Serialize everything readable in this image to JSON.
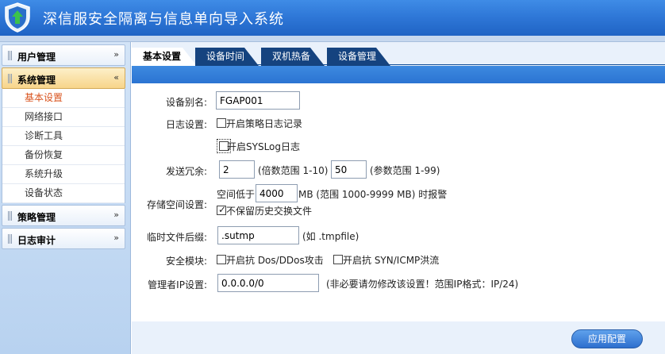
{
  "header": {
    "title": "深信服安全隔离与信息单向导入系统"
  },
  "sidebar": {
    "menus": [
      {
        "label": "用户管理",
        "chevron": "»"
      },
      {
        "label": "系统管理",
        "chevron": "«"
      },
      {
        "label": "策略管理",
        "chevron": "»"
      },
      {
        "label": "日志审计",
        "chevron": "»"
      }
    ],
    "submenu": [
      "基本设置",
      "网络接口",
      "诊断工具",
      "备份恢复",
      "系统升级",
      "设备状态"
    ]
  },
  "tabs": [
    "基本设置",
    "设备时间",
    "双机热备",
    "设备管理"
  ],
  "form": {
    "alias_label": "设备别名:",
    "alias_value": "FGAP001",
    "log_label": "日志设置:",
    "log_policy": "开启策略日志记录",
    "log_syslog": "开启SYSLog日志",
    "redundancy_label": "发送冗余:",
    "redundancy_value": "2",
    "redundancy_hint": "(倍数范围 1-10)",
    "param_value": "50",
    "param_hint": "(参数范围 1-99)",
    "storage_label": "存储空间设置:",
    "storage_prefix": "空间低于",
    "storage_value": "4000",
    "storage_suffix": "MB (范围 1000-9999 MB) 时报警",
    "storage_no_history": "不保留历史交换文件",
    "tmp_label": "临时文件后缀:",
    "tmp_value": ".sutmp",
    "tmp_hint": "(如 .tmpfile)",
    "security_label": "安全模块:",
    "security_dos": "开启抗 Dos/DDos攻击",
    "security_syn": "开启抗 SYN/ICMP洪流",
    "admin_ip_label": "管理者IP设置:",
    "admin_ip_value": "0.0.0.0/0",
    "admin_ip_hint": "(非必要请勿修改该设置！范围IP格式：IP/24)"
  },
  "apply_button": "应用配置",
  "colors": {
    "header": "#2f78d8",
    "tab": "#15437f",
    "active_sub": "#d9531e"
  }
}
